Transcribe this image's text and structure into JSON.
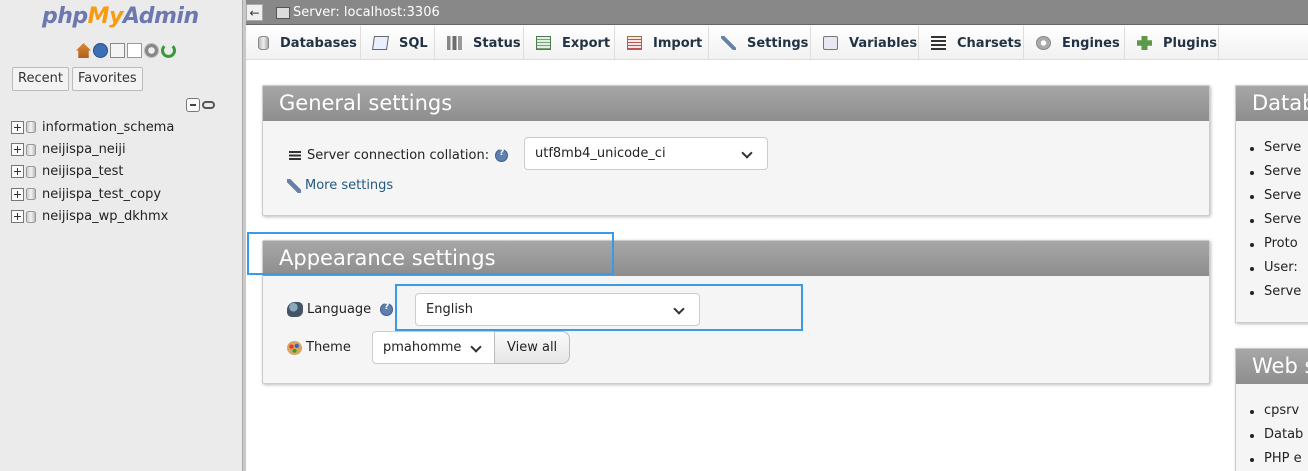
{
  "nav": {
    "logo": {
      "php": "php",
      "my": "My",
      "admin": "Admin"
    },
    "icons": [
      "home-icon",
      "help-icon",
      "document-icon",
      "docs-icon",
      "gear-icon",
      "reload-icon"
    ],
    "tabs": {
      "recent": "Recent",
      "favorites": "Favorites"
    },
    "databases": [
      "information_schema",
      "neijispa_neiji",
      "neijispa_test",
      "neijispa_test_copy",
      "neijispa_wp_dkhmx"
    ]
  },
  "topbar": {
    "back": "←",
    "server": "Server: localhost:3306"
  },
  "tabs": [
    "Databases",
    "SQL",
    "Status",
    "Export",
    "Import",
    "Settings",
    "Variables",
    "Charsets",
    "Engines",
    "Plugins"
  ],
  "general": {
    "title": "General settings",
    "collation_label": "Server connection collation:",
    "collation_value": "utf8mb4_unicode_ci",
    "more_settings": "More settings"
  },
  "appearance": {
    "title": "Appearance settings",
    "language_label": "Language",
    "language_value": "English",
    "theme_label": "Theme",
    "theme_value": "pmahomme",
    "view_all": "View all"
  },
  "database_server": {
    "title": "Datab",
    "items": [
      "Serve",
      "Serve",
      "Serve",
      "Serve",
      "Proto",
      "User:",
      "Serve"
    ]
  },
  "web_server": {
    "title": "Web s",
    "items": [
      "cpsrv",
      "Datab",
      "PHP e"
    ]
  },
  "colors": {
    "highlight": "#3b9ae8",
    "panel_header": "#999999",
    "link": "#235a81"
  }
}
